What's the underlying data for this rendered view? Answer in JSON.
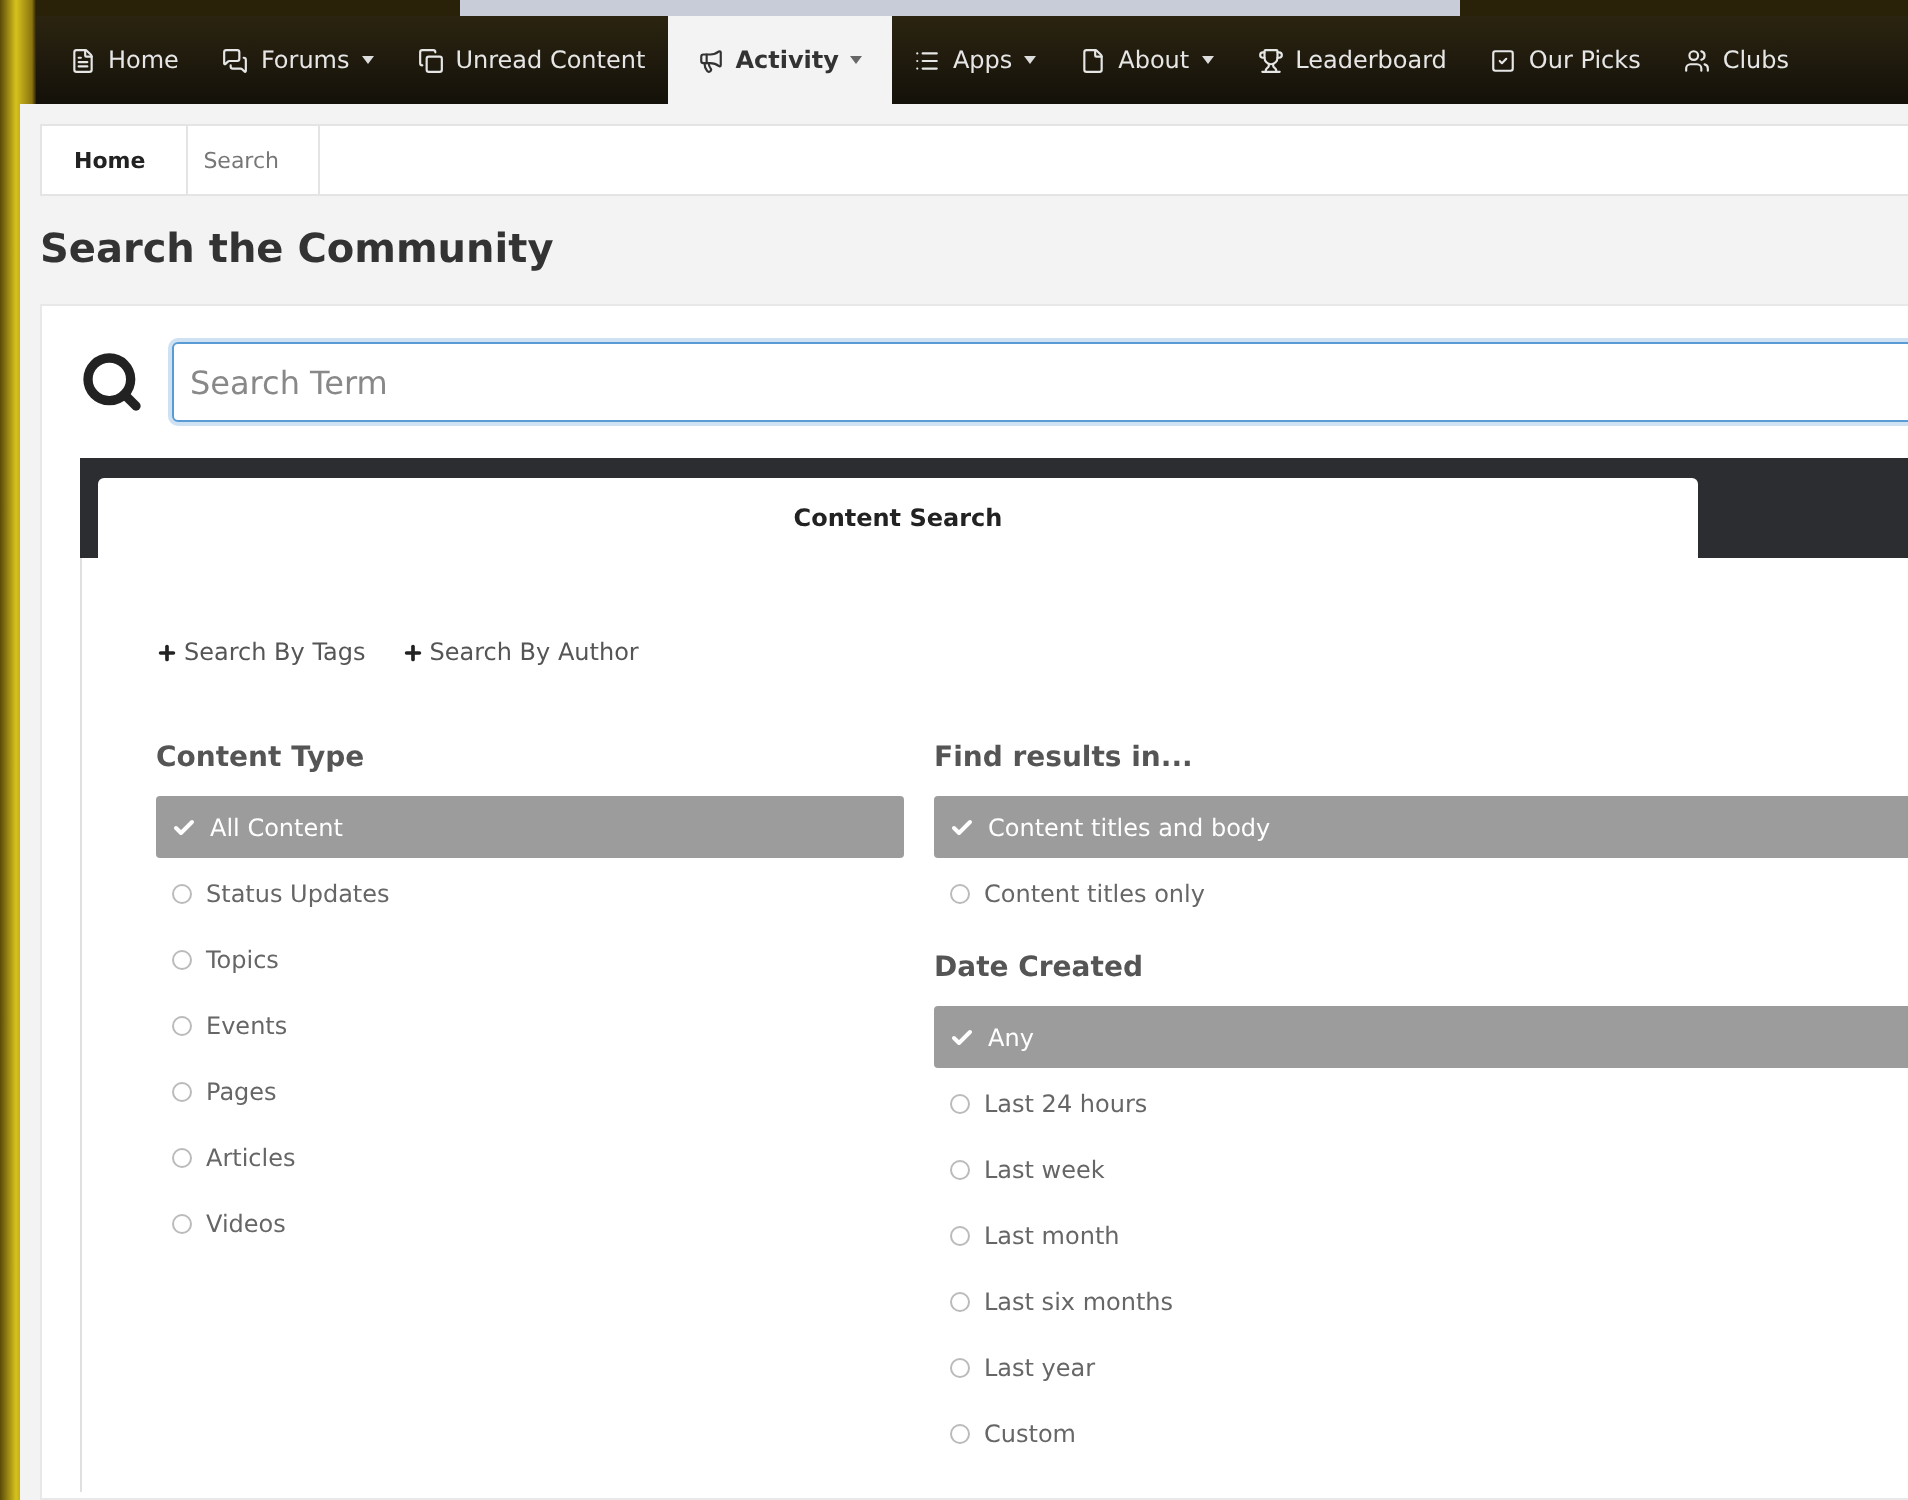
{
  "nav": [
    {
      "label": "Home",
      "dropdown": false,
      "selected": false
    },
    {
      "label": "Forums",
      "dropdown": true,
      "selected": false
    },
    {
      "label": "Unread Content",
      "dropdown": false,
      "selected": false
    },
    {
      "label": "Activity",
      "dropdown": true,
      "selected": true
    },
    {
      "label": "Apps",
      "dropdown": true,
      "selected": false
    },
    {
      "label": "About",
      "dropdown": true,
      "selected": false
    },
    {
      "label": "Leaderboard",
      "dropdown": false,
      "selected": false
    },
    {
      "label": "Our Picks",
      "dropdown": false,
      "selected": false
    },
    {
      "label": "Clubs",
      "dropdown": false,
      "selected": false
    }
  ],
  "breadcrumb": [
    "Home",
    "Search"
  ],
  "page_title": "Search the Community",
  "search": {
    "placeholder": "Search Term"
  },
  "tabs": [
    {
      "label": "Content Search",
      "selected": true
    }
  ],
  "filter_links": [
    "Search By Tags",
    "Search By Author"
  ],
  "content_type": {
    "title": "Content Type",
    "options": [
      {
        "label": "All Content",
        "selected": true
      },
      {
        "label": "Status Updates",
        "selected": false
      },
      {
        "label": "Topics",
        "selected": false
      },
      {
        "label": "Events",
        "selected": false
      },
      {
        "label": "Pages",
        "selected": false
      },
      {
        "label": "Articles",
        "selected": false
      },
      {
        "label": "Videos",
        "selected": false
      }
    ]
  },
  "find_results_in": {
    "title": "Find results in...",
    "options": [
      {
        "label": "Content titles and body",
        "selected": true
      },
      {
        "label": "Content titles only",
        "selected": false
      }
    ]
  },
  "date_created": {
    "title": "Date Created",
    "options": [
      {
        "label": "Any",
        "selected": true
      },
      {
        "label": "Last 24 hours",
        "selected": false
      },
      {
        "label": "Last week",
        "selected": false
      },
      {
        "label": "Last month",
        "selected": false
      },
      {
        "label": "Last six months",
        "selected": false
      },
      {
        "label": "Last year",
        "selected": false
      },
      {
        "label": "Custom",
        "selected": false
      }
    ]
  }
}
